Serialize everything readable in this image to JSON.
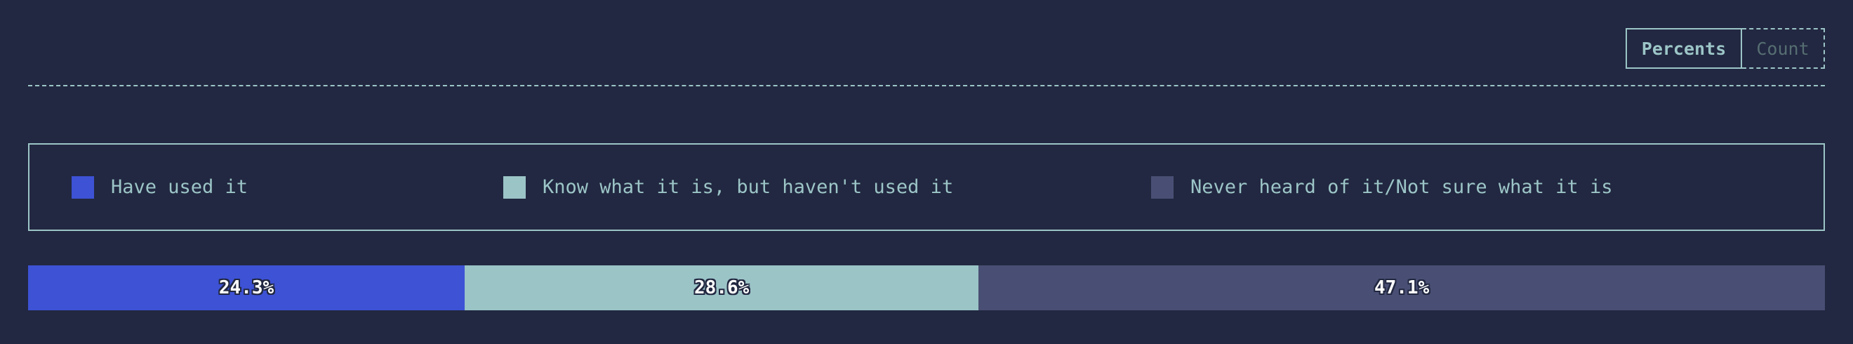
{
  "toggle": {
    "percents_label": "Percents",
    "count_label": "Count",
    "active": "Percents"
  },
  "chart_data": {
    "type": "bar",
    "orientation": "horizontal-stacked",
    "legend": "top",
    "series": [
      {
        "name": "Have used it",
        "value": 24.3,
        "label": "24.3%",
        "color": "#3d52d5"
      },
      {
        "name": "Know what it is, but haven't used it",
        "value": 28.6,
        "label": "28.6%",
        "color": "#9bc4c7"
      },
      {
        "name": "Never heard of it/Not sure what it is",
        "value": 47.1,
        "label": "47.1%",
        "color": "#494f74"
      }
    ]
  }
}
